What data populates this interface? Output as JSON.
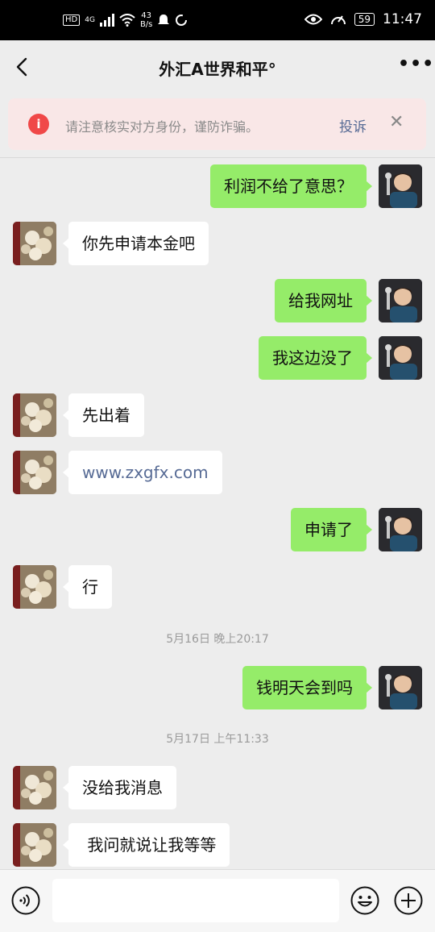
{
  "status_bar": {
    "hd": "HD",
    "network": "4G",
    "speed_value": "43",
    "speed_unit": "B/s",
    "battery": "59",
    "time": "11:47"
  },
  "header": {
    "title": "外汇A世界和平°"
  },
  "warning": {
    "text": "请注意核实对方身份，谨防诈骗。",
    "report_label": "投诉"
  },
  "messages": [
    {
      "from": "me",
      "text": "利润不给了意思？"
    },
    {
      "from": "other",
      "text": "你先申请本金吧"
    },
    {
      "from": "me",
      "text": "给我网址"
    },
    {
      "from": "me",
      "text": "我这边没了"
    },
    {
      "from": "other",
      "text": "先出着"
    },
    {
      "from": "other",
      "text": "www.zxgfx.com"
    },
    {
      "from": "me",
      "text": "申请了"
    },
    {
      "from": "other",
      "text": "行"
    },
    {
      "time": "5月16日 晚上20:17"
    },
    {
      "from": "me",
      "text": "钱明天会到吗"
    },
    {
      "time": "5月17日 上午11:33"
    },
    {
      "from": "other",
      "text": "没给我消息"
    },
    {
      "from": "other",
      "text": " 我问就说让我等等"
    }
  ],
  "colors": {
    "my_bubble": "#95ec69",
    "other_bubble": "#ffffff",
    "background": "#ededed",
    "link": "#576b95",
    "warning_bg": "#f9e7e7",
    "warning_icon": "#f04848"
  }
}
